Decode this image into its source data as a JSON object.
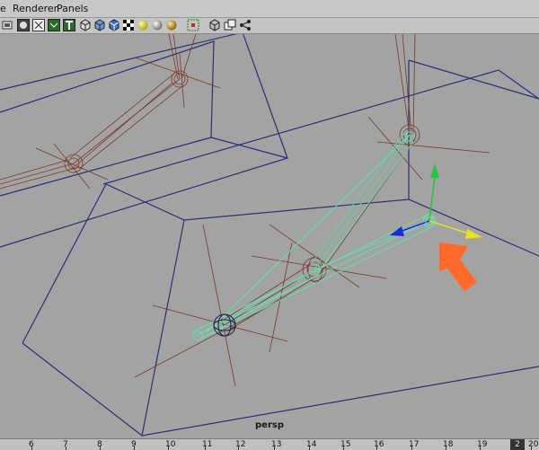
{
  "menus": [
    "e",
    "Renderer",
    "Panels"
  ],
  "toolbar": {
    "icons": [
      "camera-icon",
      "circle-icon",
      "wire-box-icon",
      "grid-box-icon",
      "text-t-icon",
      "wireframe-cube-icon",
      "shaded-cube-icon",
      "textured-cube-icon",
      "checker-icon",
      "light-sphere-icon",
      "gray-sphere-icon",
      "gold-sphere-icon",
      "isolate-icon",
      "xray-cube-icon",
      "layers-icon",
      "share-icon"
    ]
  },
  "viewport": {
    "camera_label": "persp"
  },
  "timeline": {
    "ticks": [
      "6",
      "7",
      "8",
      "9",
      "10",
      "11",
      "12",
      "13",
      "14",
      "15",
      "16",
      "17",
      "18",
      "19",
      "20"
    ],
    "current": "2"
  },
  "colors": {
    "wire_box": "#2b2f78",
    "joint": "#7a3a2a",
    "selected": "#5fe6b0",
    "arrow": "#ff6a2a",
    "axis_x_yellow": "#e8e020",
    "axis_y_green": "#22c83c",
    "axis_z_blue": "#1c2ad8"
  }
}
